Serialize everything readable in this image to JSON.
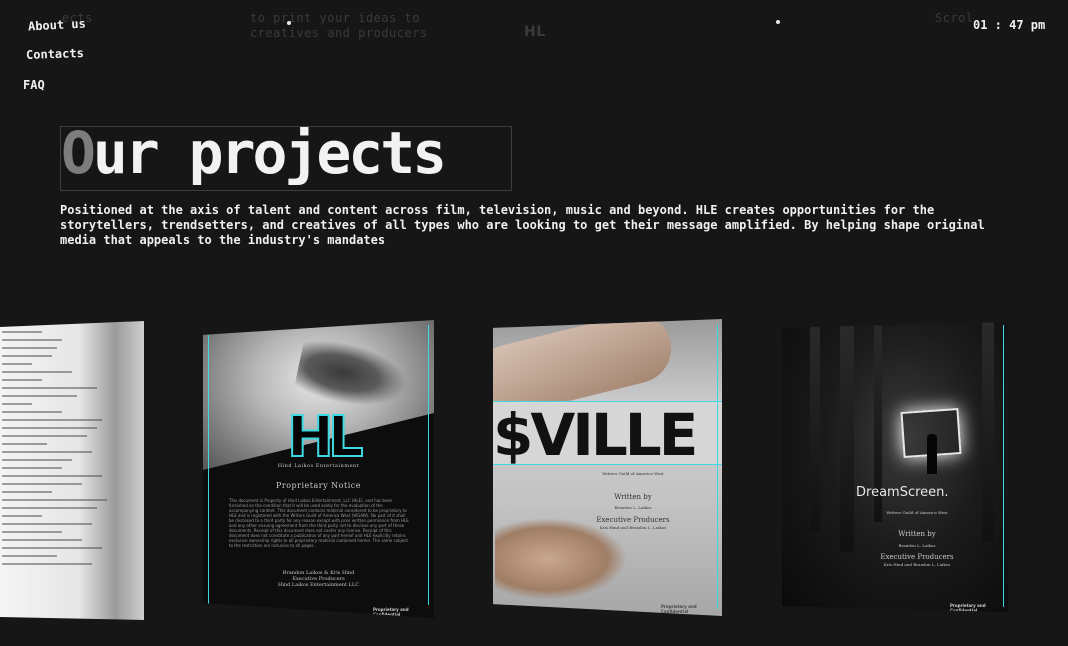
{
  "ghost_text": {
    "left": "ects",
    "middle": "to print your ideas to\ncreatives and producers",
    "logo": "HL",
    "right": "Scrol"
  },
  "nav": {
    "about": "About us",
    "contacts": "Contacts",
    "faq": "FAQ"
  },
  "clock": "01 : 47 pm",
  "hero": {
    "title_first": "O",
    "title_rest": "ur projects",
    "description": "Positioned at the axis of talent and content across film, television, music and beyond. HLE creates opportunities for the storytellers, trendsetters, and creatives of all types who are looking to get their message amplified. By helping shape original media that appeals to the industry's mandates"
  },
  "cards": {
    "card2": {
      "logo": "HL",
      "company": "Hind Laikos Entertainment",
      "notice_title": "Proprietary Notice",
      "notice_text": "This document is Property of Hind Laikos Entertainment, LLC (HLE), and has been furnished on the condition that it will be used solely for the evaluation of the accompanying content. This document contains material considered to be proprietary to HLE and is registered with the Writers Guild of America West (WGAW). No part of it shall be disclosed to a third party for any reason except with prior written permission from HLE and any other ensuing agreement from the third party not to disclose any part of these documents. Receipt of this document does not confer any license. Receipt of this document does not constitute a publication of any part hereof and HLE explicitly retains exclusive ownership rights to all proprietary material contained herein. The same subject to the restriction are inclusive to all pages.",
      "credit1": "Brandon Laikos & Kris Hind",
      "credit2": "Executive Producers",
      "credit3": "Hind Laikos Entertainment LLC",
      "footer": "Proprietary and Confidential"
    },
    "card3": {
      "title": "$VILLE",
      "wga": "Writers Guild of America West",
      "written_by": "Written by",
      "writer": "Brandon L. Laikos",
      "exec": "Executive Producers",
      "producers": "Kris Hind and Brandon L. Laikos",
      "footer": "Proprietary and Confidential"
    },
    "card4": {
      "title": "DreamScreen.",
      "wga": "Writers Guild of America West",
      "written_by": "Written by",
      "writer": "Brandon L. Laikos",
      "exec": "Executive Producers",
      "producers": "Kris Hind and Brandon L. Laikos",
      "footer": "Proprietary and Confidential"
    }
  }
}
